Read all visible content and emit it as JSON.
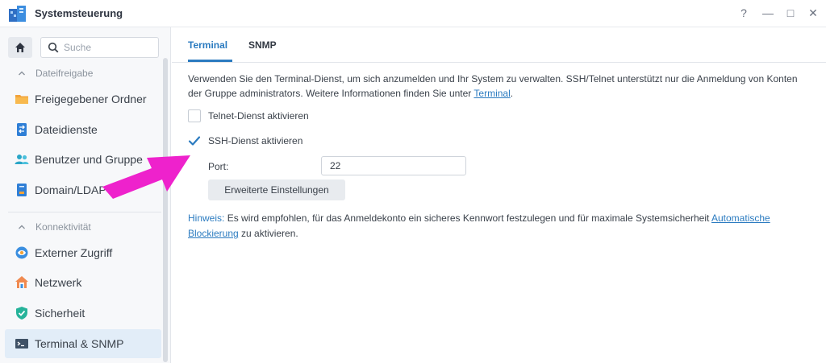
{
  "window": {
    "title": "Systemsteuerung",
    "controls": {
      "help": "?",
      "minimize": "—",
      "maximize": "□",
      "close": "✕"
    }
  },
  "sidebar": {
    "search_placeholder": "Suche",
    "sections": [
      {
        "label": "Dateifreigabe",
        "items": [
          {
            "label": "Freigegebener Ordner",
            "icon": "shared-folder-icon"
          },
          {
            "label": "Dateidienste",
            "icon": "file-services-icon"
          },
          {
            "label": "Benutzer und Gruppe",
            "icon": "users-icon"
          },
          {
            "label": "Domain/LDAP",
            "icon": "domain-ldap-icon"
          }
        ]
      },
      {
        "label": "Konnektivität",
        "items": [
          {
            "label": "Externer Zugriff",
            "icon": "external-access-icon"
          },
          {
            "label": "Netzwerk",
            "icon": "network-icon"
          },
          {
            "label": "Sicherheit",
            "icon": "security-shield-icon"
          },
          {
            "label": "Terminal & SNMP",
            "icon": "terminal-icon",
            "active": true
          }
        ]
      }
    ]
  },
  "tabs": [
    {
      "label": "Terminal",
      "active": true
    },
    {
      "label": "SNMP",
      "active": false
    }
  ],
  "terminal": {
    "description": "Verwenden Sie den Terminal-Dienst, um sich anzumelden und Ihr System zu verwalten. SSH/Telnet unterstützt nur die Anmeldung von Konten der Gruppe administrators. Weitere Informationen finden Sie unter ",
    "description_link": "Terminal",
    "description_end": ".",
    "telnet_label": "Telnet-Dienst aktivieren",
    "telnet_checked": false,
    "ssh_label": "SSH-Dienst aktivieren",
    "ssh_checked": true,
    "port_label": "Port:",
    "port_value": "22",
    "advanced_button": "Erweiterte Einstellungen",
    "hint_prefix": "Hinweis:",
    "hint_text": " Es wird empfohlen, für das Anmeldekonto ein sicheres Kennwort festzulegen und für maximale Systemsicherheit ",
    "hint_link": "Automatische Blockierung",
    "hint_end": " zu aktivieren."
  },
  "colors": {
    "accent": "#2b7bc0",
    "annotation_arrow": "#ee22cc",
    "active_item_bg": "#e2edf8"
  }
}
